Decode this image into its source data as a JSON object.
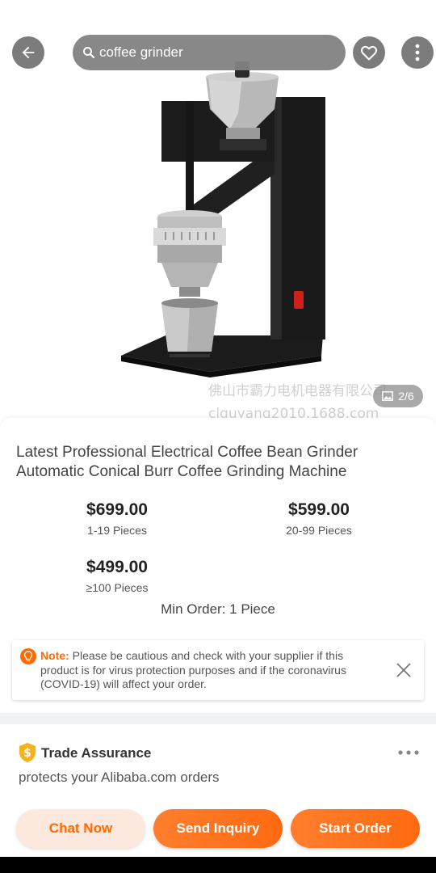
{
  "search": {
    "query": "coffee grinder"
  },
  "gallery": {
    "counter": "2/6",
    "watermark_line1": "佛山市霸力电机电器有限公司",
    "watermark_line2": "clguyang2010.1688.com"
  },
  "product": {
    "title": "Latest Professional Electrical Coffee Bean Grinder Automatic Conical Burr Coffee Grinding Machine",
    "prices": [
      {
        "price": "$699.00",
        "range": "1-19 Pieces"
      },
      {
        "price": "$599.00",
        "range": "20-99 Pieces"
      },
      {
        "price": "$499.00",
        "range": "≥100 Pieces"
      }
    ],
    "min_order": "Min Order: 1 Piece"
  },
  "note": {
    "label": "Note:",
    "text": "Please be cautious and check with your supplier if this product is for virus protection purposes and if the coronavirus (COVID-19) will affect your order."
  },
  "trade_assurance": {
    "title": "Trade Assurance",
    "subtitle": "protects your Alibaba.com orders"
  },
  "actions": {
    "chat": "Chat Now",
    "inquiry": "Send Inquiry",
    "order": "Start Order"
  },
  "icons": {
    "back": "arrow-left-icon",
    "search": "search-icon",
    "favorite": "heart-icon",
    "more": "vertical-dots-icon",
    "image_counter": "image-icon",
    "note": "bulb-icon",
    "close": "close-icon",
    "trade": "shield-dollar-icon",
    "trade_more": "horizontal-dots-icon"
  },
  "colors": {
    "accent": "#ff6a00",
    "chat_bg": "#fde8dd",
    "divider": "#f1f2f4"
  }
}
